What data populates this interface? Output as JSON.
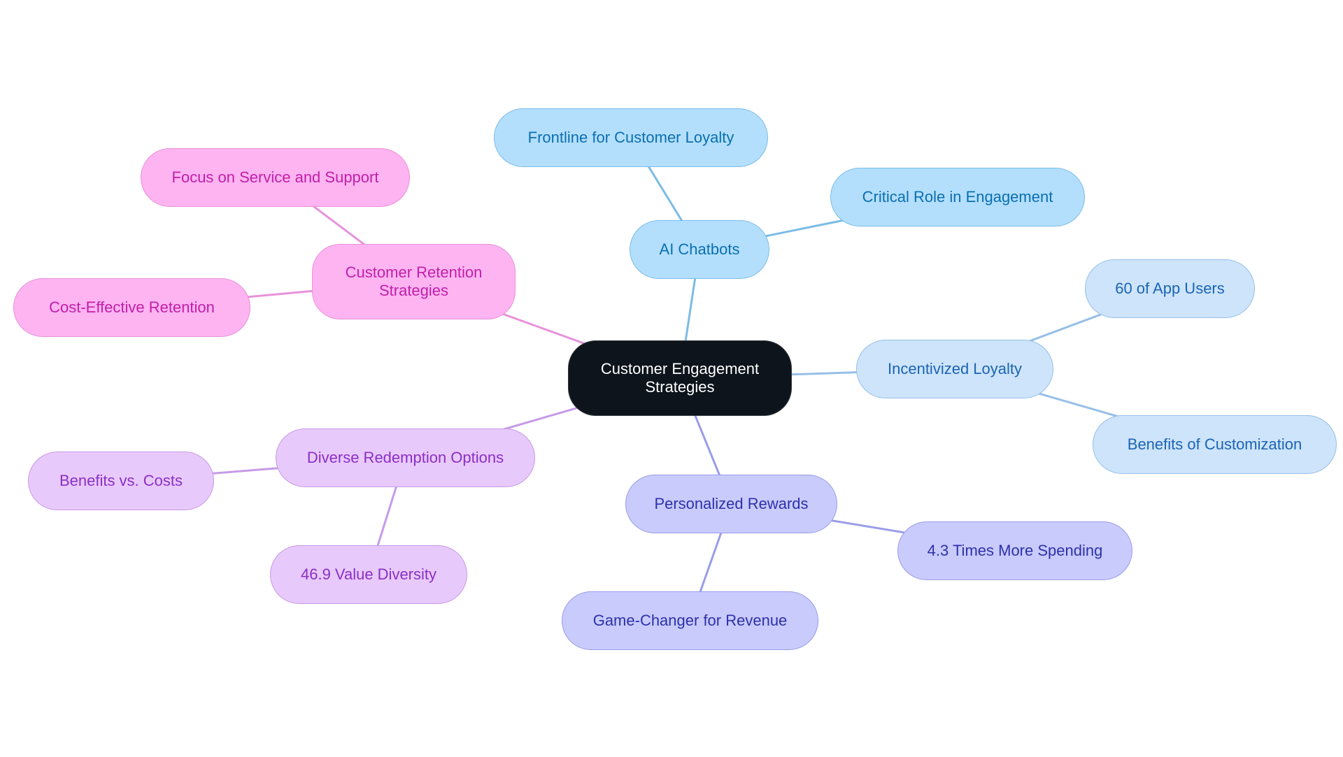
{
  "diagram": {
    "type": "mindmap",
    "root": {
      "id": "root",
      "label_lines": [
        "Customer Engagement",
        "Strategies"
      ],
      "fill": "#0d141b",
      "stroke": "#333a40",
      "text": "#ffffff"
    },
    "branches": [
      {
        "id": "ai-chatbots",
        "label_lines": [
          "AI Chatbots"
        ],
        "palette": {
          "fill": "#b3dffd",
          "stroke": "#7bbce6",
          "text": "#0b6fb0",
          "edge": "#7bbce6"
        },
        "children": [
          {
            "id": "frontline",
            "label_lines": [
              "Frontline for Customer Loyalty"
            ]
          },
          {
            "id": "critical-role",
            "label_lines": [
              "Critical Role in Engagement"
            ]
          }
        ]
      },
      {
        "id": "incentivized-loyalty",
        "label_lines": [
          "Incentivized Loyalty"
        ],
        "palette": {
          "fill": "#cde4fb",
          "stroke": "#97bfe8",
          "text": "#1b64b3",
          "edge": "#97bfe8"
        },
        "children": [
          {
            "id": "app-users",
            "label_lines": [
              "60 of App Users"
            ]
          },
          {
            "id": "customization",
            "label_lines": [
              "Benefits of Customization"
            ]
          }
        ]
      },
      {
        "id": "personalized-rewards",
        "label_lines": [
          "Personalized Rewards"
        ],
        "palette": {
          "fill": "#c8cbfc",
          "stroke": "#9a9de8",
          "text": "#2e31a8",
          "edge": "#9a9de8"
        },
        "children": [
          {
            "id": "spending",
            "label_lines": [
              "4.3 Times More Spending"
            ]
          },
          {
            "id": "game-changer",
            "label_lines": [
              "Game-Changer for Revenue"
            ]
          }
        ]
      },
      {
        "id": "diverse-redemption",
        "label_lines": [
          "Diverse Redemption Options"
        ],
        "palette": {
          "fill": "#e8c9fb",
          "stroke": "#c69ae8",
          "text": "#8a2fc6",
          "edge": "#c69ae8"
        },
        "children": [
          {
            "id": "benefits-costs",
            "label_lines": [
              "Benefits vs. Costs"
            ]
          },
          {
            "id": "value-diversity",
            "label_lines": [
              "46.9 Value Diversity"
            ]
          }
        ]
      },
      {
        "id": "customer-retention",
        "label_lines": [
          "Customer Retention",
          "Strategies"
        ],
        "palette": {
          "fill": "#fdb4f1",
          "stroke": "#e892da",
          "text": "#c21ea8",
          "edge": "#e892da"
        },
        "children": [
          {
            "id": "service-support",
            "label_lines": [
              "Focus on Service and Support"
            ]
          },
          {
            "id": "cost-effective",
            "label_lines": [
              "Cost-Effective Retention"
            ]
          }
        ]
      }
    ]
  }
}
